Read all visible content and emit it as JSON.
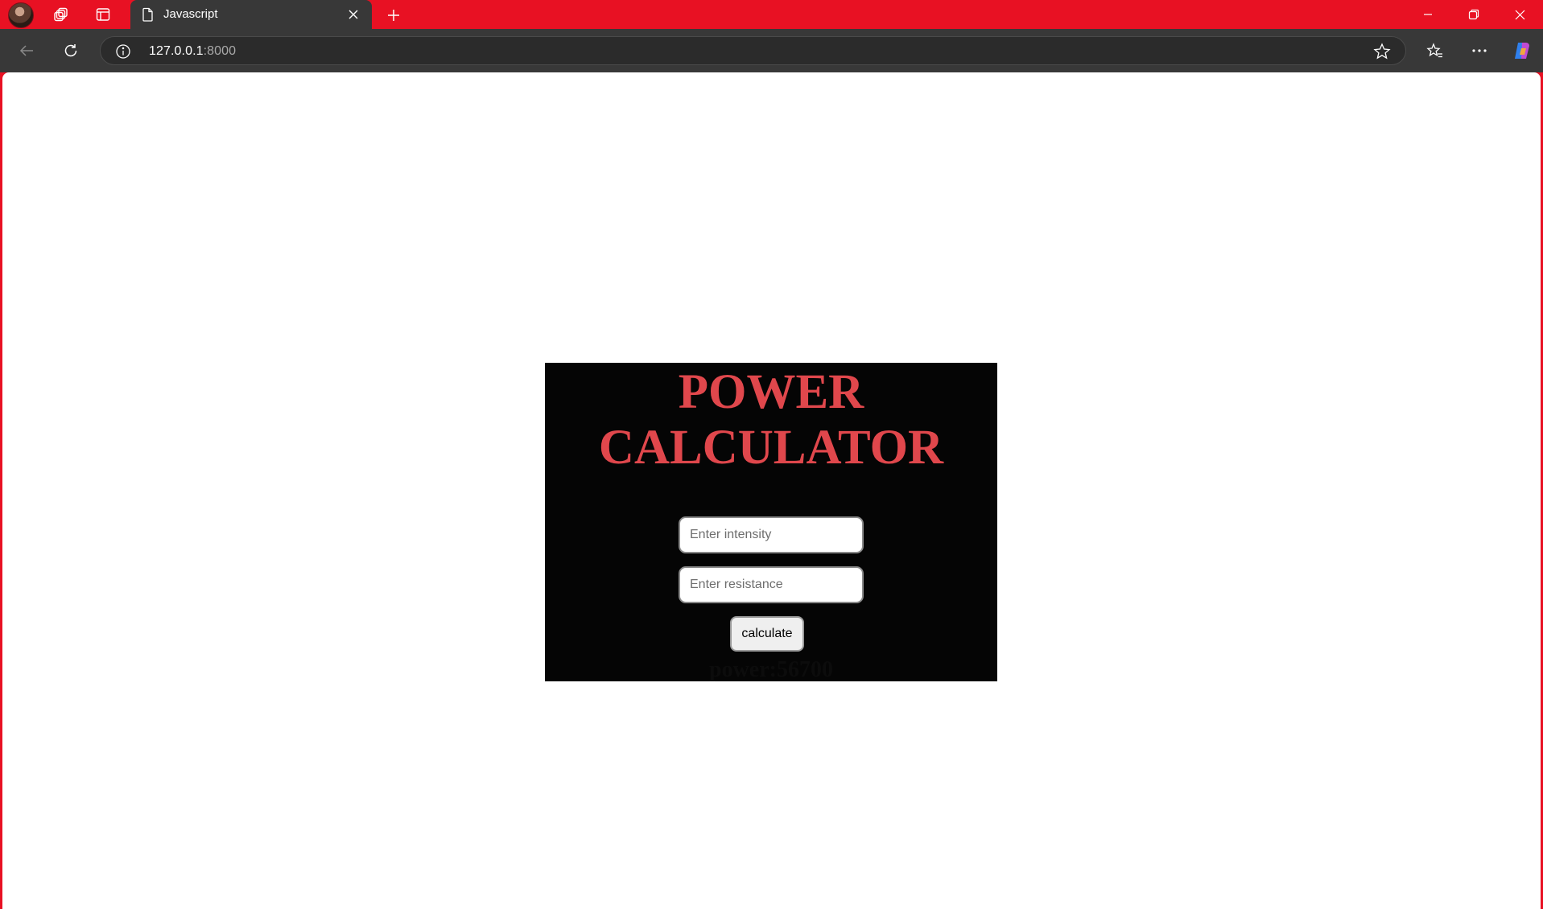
{
  "browser": {
    "tab": {
      "title": "Javascript"
    },
    "address": {
      "host": "127.0.0.1",
      "port": ":8000"
    }
  },
  "page": {
    "heading": "POWER CALCULATOR",
    "intensity_input": {
      "placeholder": "Enter intensity",
      "value": ""
    },
    "resistance_input": {
      "placeholder": "Enter resistance",
      "value": ""
    },
    "calculate_label": "calculate",
    "result": "power:56700"
  },
  "colors": {
    "titlebar": "#e81123",
    "heading": "#e0474c",
    "card_background": "#050505"
  },
  "icons": [
    "avatar",
    "workspaces-icon",
    "tab-actions-icon",
    "document-icon",
    "close-icon",
    "plus-icon",
    "minimize-icon",
    "restore-icon",
    "window-close-icon",
    "back-icon",
    "refresh-icon",
    "info-icon",
    "star-icon",
    "favorites-icon",
    "more-icon",
    "copilot-icon"
  ]
}
